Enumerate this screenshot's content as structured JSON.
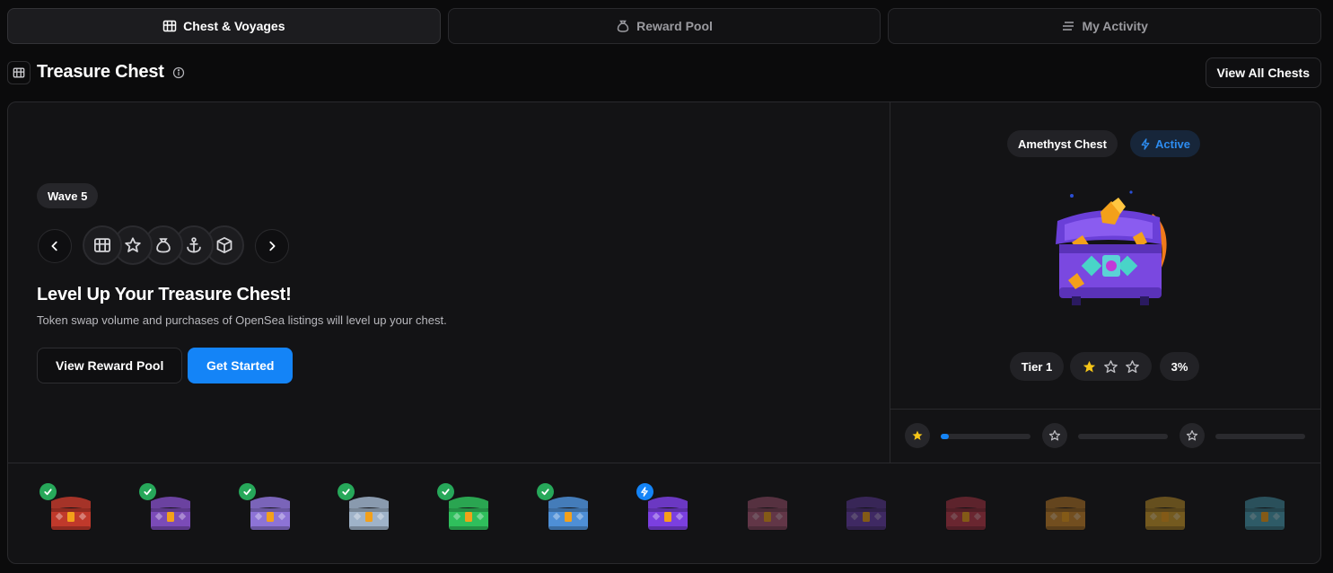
{
  "tabs": [
    {
      "label": "Chest & Voyages",
      "icon": "chest-icon",
      "active": true
    },
    {
      "label": "Reward Pool",
      "icon": "money-bag-icon",
      "active": false
    },
    {
      "label": "My Activity",
      "icon": "activity-lines-icon",
      "active": false
    }
  ],
  "header": {
    "title": "Treasure Chest",
    "view_all_label": "View All Chests"
  },
  "wave": {
    "label": "Wave 5",
    "steps": [
      {
        "icon": "chest-icon",
        "active": true
      },
      {
        "icon": "star-icon",
        "active": false
      },
      {
        "icon": "money-bag-icon",
        "active": false
      },
      {
        "icon": "anchor-icon",
        "active": false
      },
      {
        "icon": "box-icon",
        "active": false
      }
    ]
  },
  "hero": {
    "title": "Level Up Your Treasure Chest!",
    "description": "Token swap volume and purchases of OpenSea listings will level up your chest.",
    "secondary_button": "View Reward Pool",
    "primary_button": "Get Started"
  },
  "current_chest": {
    "name": "Amethyst Chest",
    "status": "Active",
    "tier_label": "Tier 1",
    "stars_filled": 1,
    "stars_total": 3,
    "progress_label": "3%",
    "progress_fraction": 0.03
  },
  "chest_strip": [
    {
      "state": "completed",
      "color": "#c0392b"
    },
    {
      "state": "completed",
      "color": "#7b4bb8"
    },
    {
      "state": "completed",
      "color": "#8d73d6"
    },
    {
      "state": "completed",
      "color": "#9fb3c9"
    },
    {
      "state": "completed",
      "color": "#2fbf5c"
    },
    {
      "state": "completed",
      "color": "#4e8fd6"
    },
    {
      "state": "current",
      "color": "#7b3fe0"
    },
    {
      "state": "locked",
      "color": "#b05a7a"
    },
    {
      "state": "locked",
      "color": "#6b3fb0"
    },
    {
      "state": "locked",
      "color": "#c0394b"
    },
    {
      "state": "locked",
      "color": "#d08a2a"
    },
    {
      "state": "locked",
      "color": "#d4a02a"
    },
    {
      "state": "locked",
      "color": "#4aa3b8"
    }
  ],
  "colors": {
    "accent": "#1484f7",
    "success": "#27a85a",
    "star": "#f5c518"
  }
}
